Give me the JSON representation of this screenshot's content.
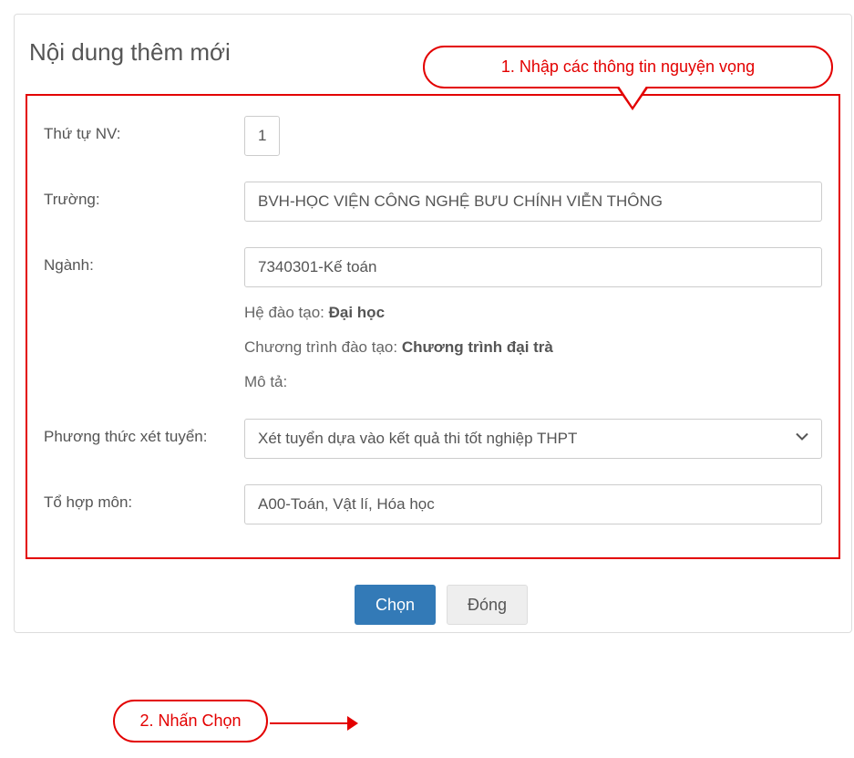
{
  "title": "Nội dung thêm mới",
  "callout1": "1. Nhập các thông tin nguyện vọng",
  "callout2": "2. Nhấn Chọn",
  "labels": {
    "order": "Thứ tự NV:",
    "school": "Trường:",
    "major": "Ngành:",
    "method": "Phương thức xét tuyển:",
    "subjects": "Tổ hợp môn:"
  },
  "info": {
    "system_label": "Hệ đào tạo: ",
    "system_value": "Đại học",
    "program_label": "Chương trình đào tạo: ",
    "program_value": "Chương trình đại trà",
    "desc_label": "Mô tả:"
  },
  "values": {
    "order": "1",
    "school": "BVH-HỌC VIỆN CÔNG NGHỆ BƯU CHÍNH VIỄN THÔNG",
    "major": "7340301-Kế toán",
    "method": "Xét tuyển dựa vào kết quả thi tốt nghiệp THPT",
    "subjects": "A00-Toán, Vật lí, Hóa học"
  },
  "buttons": {
    "choose": "Chọn",
    "close": "Đóng"
  }
}
